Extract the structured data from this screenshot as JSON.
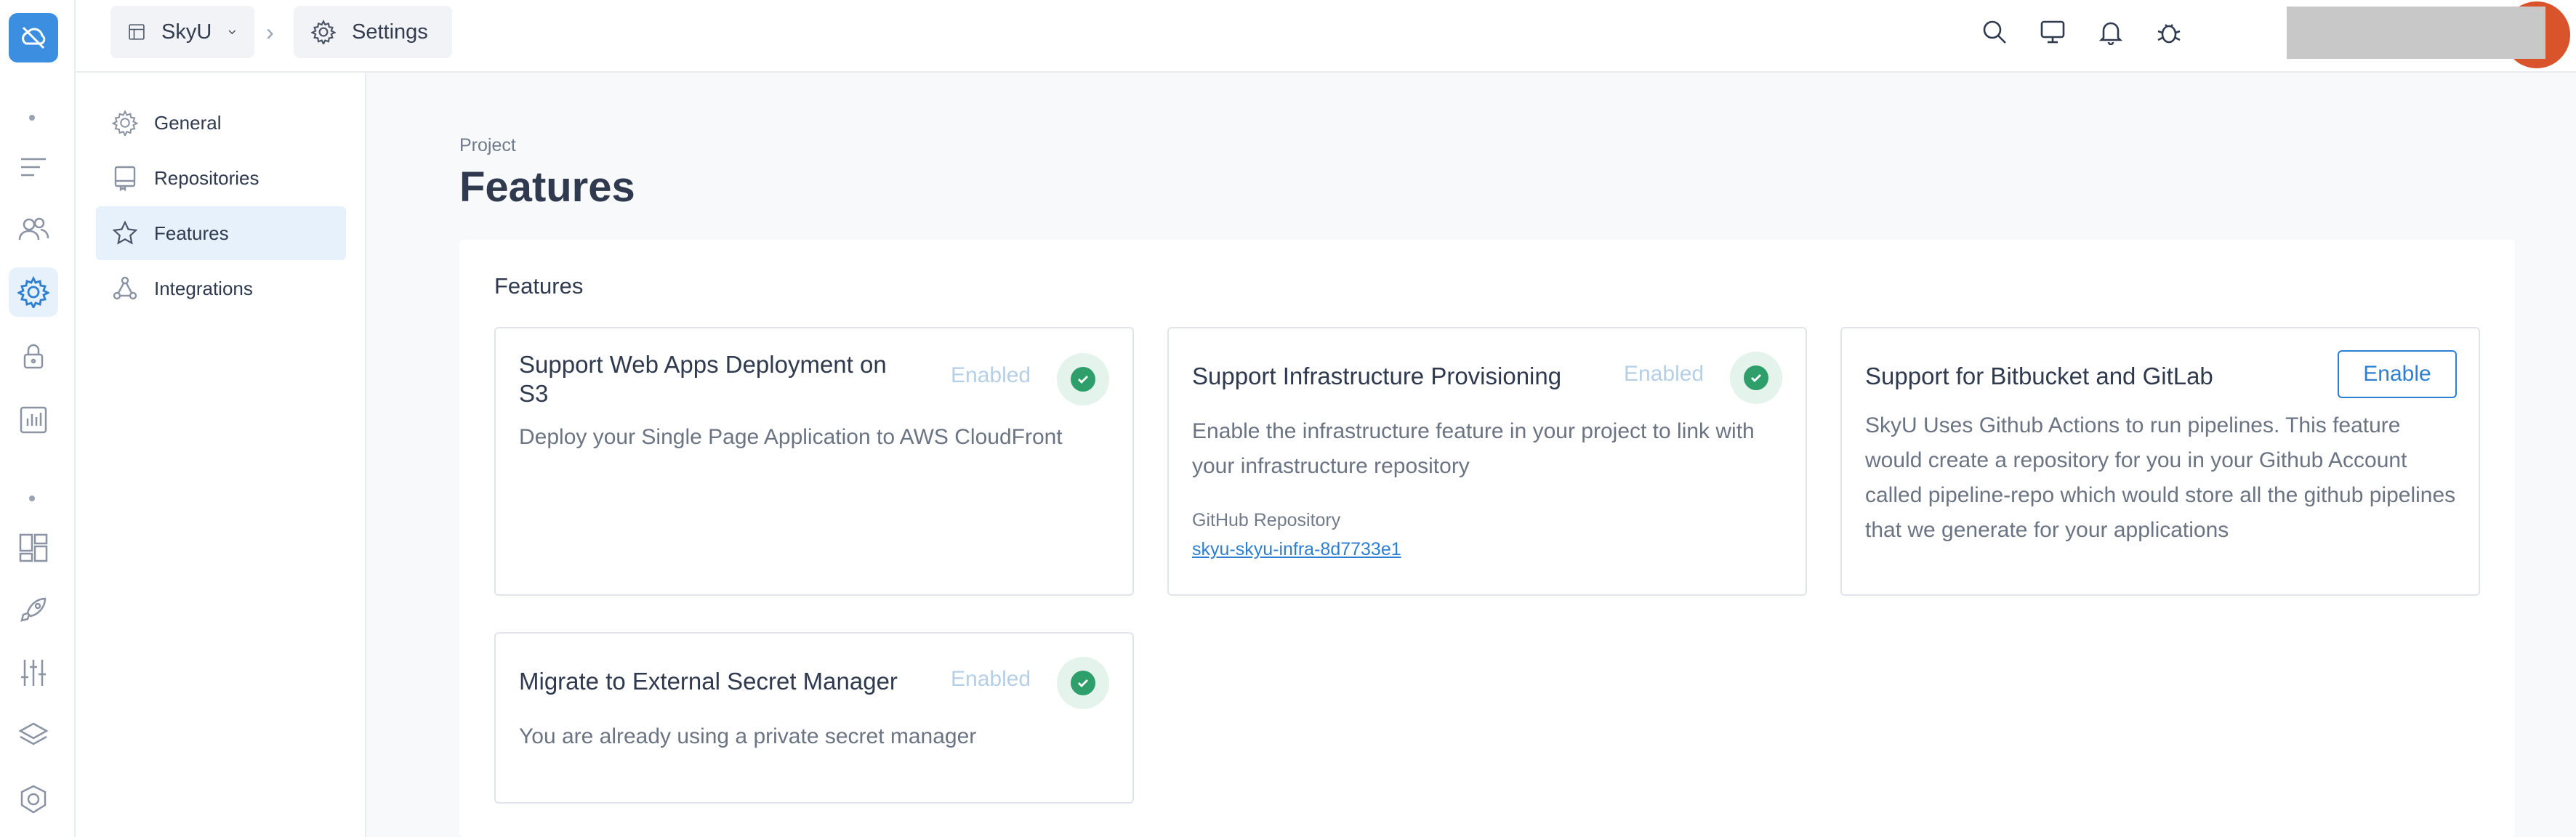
{
  "breadcrumb": {
    "project": "SkyU",
    "separator": "›",
    "section": "Settings"
  },
  "sidebar": {
    "items": [
      {
        "label": "General",
        "icon": "gear-icon"
      },
      {
        "label": "Repositories",
        "icon": "repository-icon"
      },
      {
        "label": "Features",
        "icon": "star-icon",
        "active": true
      },
      {
        "label": "Integrations",
        "icon": "integrations-icon"
      }
    ]
  },
  "page": {
    "subtitle": "Project",
    "title": "Features"
  },
  "panel": {
    "title": "Features"
  },
  "features": [
    {
      "title": "Support Web Apps Deployment on S3",
      "status": "Enabled",
      "description": "Deploy your Single Page Application to AWS CloudFront"
    },
    {
      "title": "Support Infrastructure Provisioning",
      "status": "Enabled",
      "description": "Enable the infrastructure feature in your project to link with your infrastructure repository",
      "repo_label": "GitHub Repository",
      "repo_name": "skyu-skyu-infra-8d7733e1"
    },
    {
      "title": "Support for Bitbucket and GitLab",
      "button": "Enable",
      "description": "SkyU Uses Github Actions to run pipelines. This feature would create a repository for you in your Github Account called pipeline-repo which would store all the github pipelines that we generate for your applications"
    },
    {
      "title": "Migrate to External Secret Manager",
      "status": "Enabled",
      "description": "You are already using a private secret manager"
    }
  ],
  "colors": {
    "accent": "#3b8ee0",
    "link": "#2d7fd4",
    "success": "#2e9e6a",
    "enabled_text": "#b5cfe6"
  }
}
